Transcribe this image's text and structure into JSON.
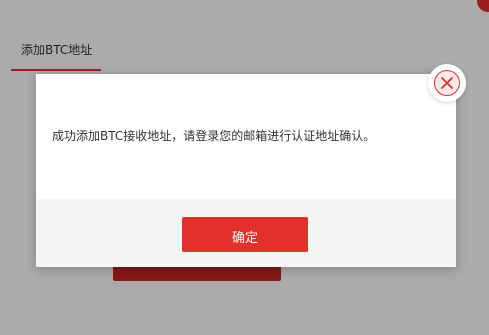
{
  "background": {
    "tab_label": "添加BTC地址"
  },
  "modal": {
    "message": "成功添加BTC接收地址，请登录您的邮箱进行认证地址确认。",
    "confirm_label": "确定",
    "close_icon": "close-icon"
  },
  "colors": {
    "accent": "#e3302b",
    "overlay": "rgba(0,0,0,0.33)",
    "footer": "#f5f5f5"
  }
}
